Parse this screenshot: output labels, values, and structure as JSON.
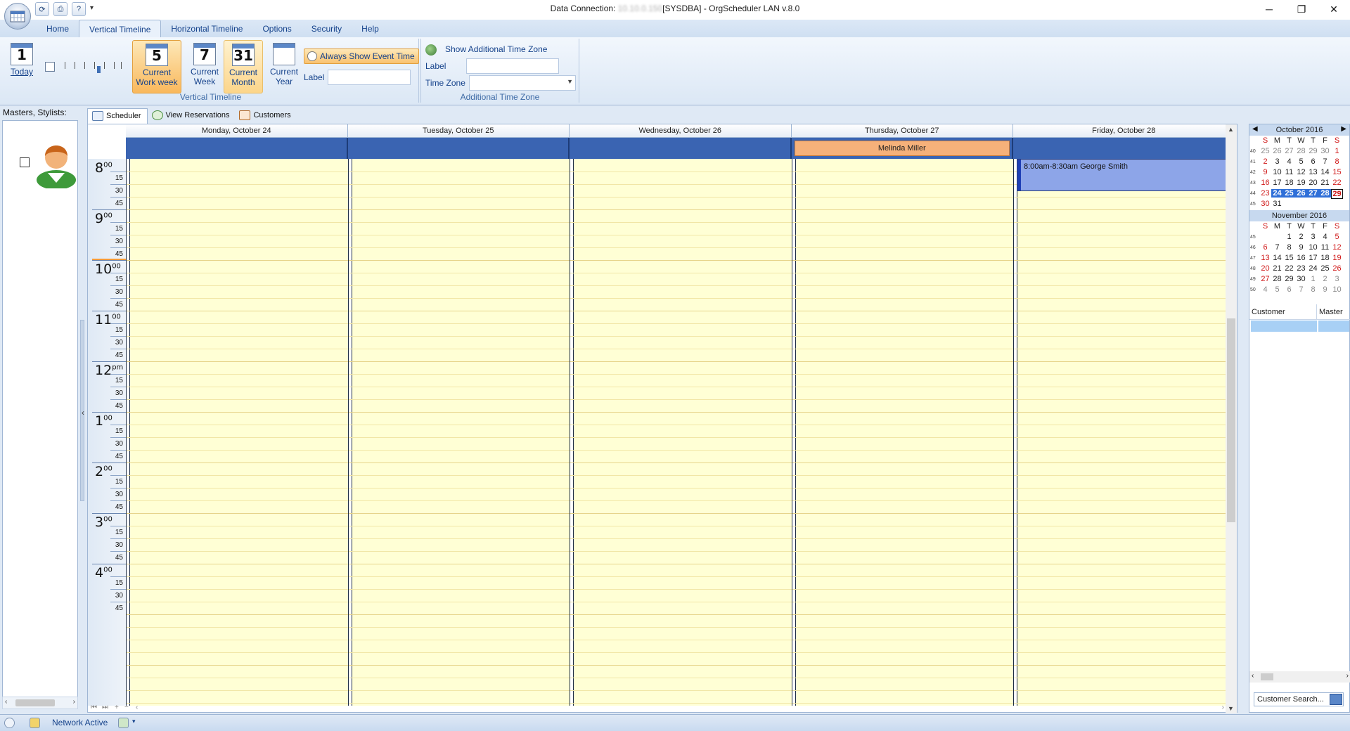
{
  "window": {
    "title_prefix": "Data Connection:",
    "title_blurred": "10.10.0.150",
    "title_suffix": "[SYSDBA] - OrgScheduler LAN v.8.0",
    "minimize": "─",
    "restore": "❐",
    "close": "✕"
  },
  "ribbon_tabs": [
    "Home",
    "Vertical Timeline",
    "Horizontal Timeline",
    "Options",
    "Security",
    "Help"
  ],
  "ribbon": {
    "today": {
      "num": "1",
      "label": "Today"
    },
    "work_week": {
      "num": "5",
      "line1": "Current",
      "line2": "Work week"
    },
    "week": {
      "num": "7",
      "line1": "Current",
      "line2": "Week"
    },
    "month": {
      "num": "31",
      "line1": "Current",
      "line2": "Month"
    },
    "year": {
      "line1": "Current",
      "line2": "Year"
    },
    "always_show": "Always Show Event Time",
    "label_left": "Label",
    "group_vertical": "Vertical Timeline",
    "show_tz": "Show Additional Time Zone",
    "tz_label": "Label",
    "tz_zone": "Time Zone",
    "group_tz": "Additional Time Zone"
  },
  "left_panel": {
    "header": "Masters, Stylists:"
  },
  "doc_tabs": [
    "Scheduler",
    "View Reservations",
    "Customers"
  ],
  "scheduler": {
    "days": [
      "Monday, October 24",
      "Tuesday, October 25",
      "Wednesday, October 26",
      "Thursday, October 27",
      "Friday, October 28"
    ],
    "allday_event": {
      "day_index": 3,
      "text": "Melinda Miller"
    },
    "hours": [
      {
        "h": "8",
        "m": "00"
      },
      {
        "h": "9",
        "m": "00"
      },
      {
        "h": "10",
        "m": "00"
      },
      {
        "h": "11",
        "m": "00"
      },
      {
        "h": "12",
        "m": "pm"
      },
      {
        "h": "1",
        "m": "00"
      },
      {
        "h": "2",
        "m": "00"
      },
      {
        "h": "3",
        "m": "00"
      },
      {
        "h": "4",
        "m": "00"
      }
    ],
    "quarter_labels": [
      "15",
      "30",
      "45"
    ],
    "event": {
      "day_index": 4,
      "text": "8:00am-8:30am George Smith"
    }
  },
  "mini_cal": {
    "dow": [
      "S",
      "M",
      "T",
      "W",
      "T",
      "F",
      "S"
    ],
    "october": {
      "title": "October 2016",
      "rows": [
        {
          "wk": "40",
          "days": [
            "25",
            "26",
            "27",
            "28",
            "29",
            "30",
            "1"
          ]
        },
        {
          "wk": "41",
          "days": [
            "2",
            "3",
            "4",
            "5",
            "6",
            "7",
            "8"
          ]
        },
        {
          "wk": "42",
          "days": [
            "9",
            "10",
            "11",
            "12",
            "13",
            "14",
            "15"
          ]
        },
        {
          "wk": "43",
          "days": [
            "16",
            "17",
            "18",
            "19",
            "20",
            "21",
            "22"
          ]
        },
        {
          "wk": "44",
          "days": [
            "23",
            "24",
            "25",
            "26",
            "27",
            "28",
            "29"
          ]
        },
        {
          "wk": "45",
          "days": [
            "30",
            "31",
            "",
            "",
            "",
            "",
            ""
          ]
        }
      ]
    },
    "november": {
      "title": "November 2016",
      "rows": [
        {
          "wk": "45",
          "days": [
            "",
            "",
            "1",
            "2",
            "3",
            "4",
            "5"
          ]
        },
        {
          "wk": "46",
          "days": [
            "6",
            "7",
            "8",
            "9",
            "10",
            "11",
            "12"
          ]
        },
        {
          "wk": "47",
          "days": [
            "13",
            "14",
            "15",
            "16",
            "17",
            "18",
            "19"
          ]
        },
        {
          "wk": "48",
          "days": [
            "20",
            "21",
            "22",
            "23",
            "24",
            "25",
            "26"
          ]
        },
        {
          "wk": "49",
          "days": [
            "27",
            "28",
            "29",
            "30",
            "1",
            "2",
            "3"
          ]
        },
        {
          "wk": "50",
          "days": [
            "4",
            "5",
            "6",
            "7",
            "8",
            "9",
            "10"
          ]
        }
      ]
    }
  },
  "customer_table": {
    "col1": "Customer",
    "col2": "Master"
  },
  "customer_search": "Customer Search...",
  "status": {
    "network": "Network Active"
  }
}
